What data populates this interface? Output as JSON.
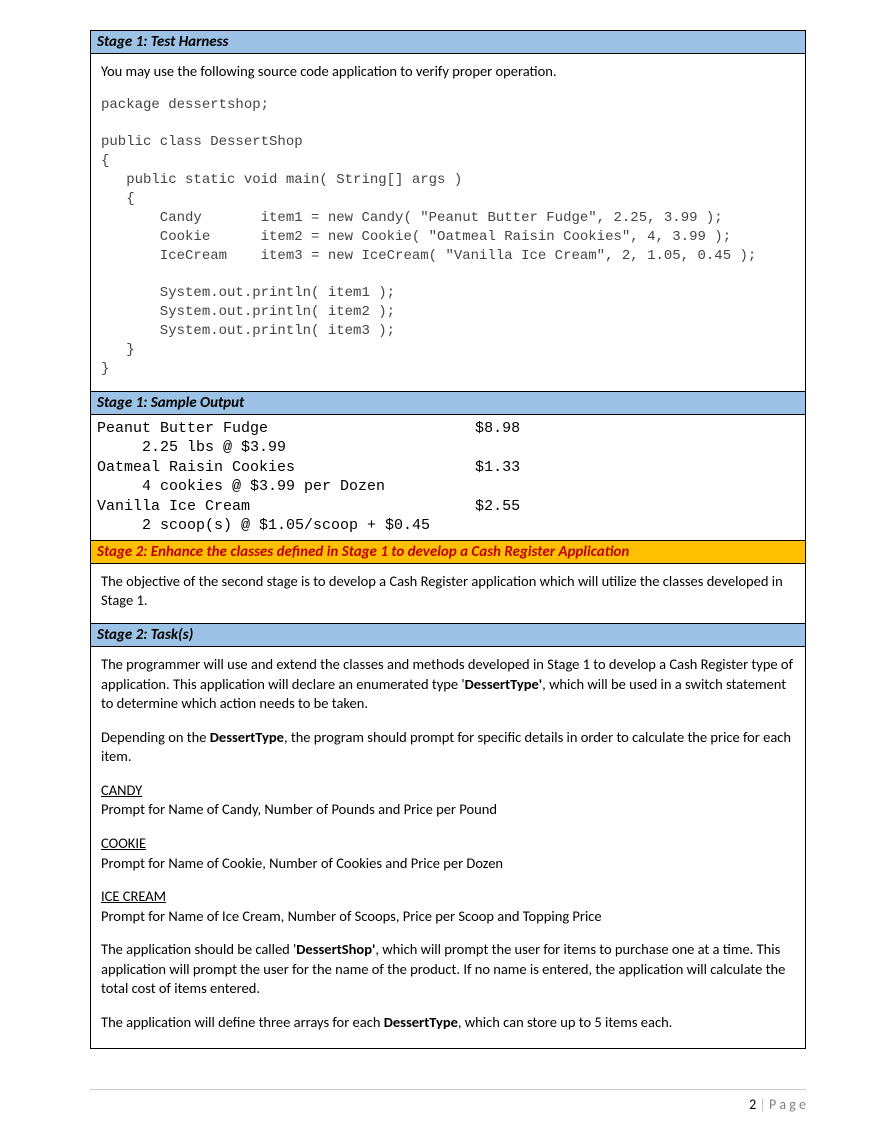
{
  "headers": {
    "s1": "Stage 1: Test Harness",
    "s1out": "Stage 1: Sample Output",
    "s2title": "Stage 2: Enhance the classes defined in Stage 1 to develop a Cash Register Application",
    "s2tasks": "Stage 2:  Task(s)"
  },
  "harness": {
    "intro": "You may use the following source code application to verify proper operation.",
    "code": "package dessertshop;\n\npublic class DessertShop\n{\n   public static void main( String[] args )\n   {\n       Candy       item1 = new Candy( \"Peanut Butter Fudge\", 2.25, 3.99 );\n       Cookie      item2 = new Cookie( \"Oatmeal Raisin Cookies\", 4, 3.99 );\n       IceCream    item3 = new IceCream( \"Vanilla Ice Cream\", 2, 1.05, 0.45 );\n\n       System.out.println( item1 );\n       System.out.println( item2 );\n       System.out.println( item3 );\n   }\n}"
  },
  "output": "Peanut Butter Fudge                       $8.98\n     2.25 lbs @ $3.99\nOatmeal Raisin Cookies                    $1.33\n     4 cookies @ $3.99 per Dozen\nVanilla Ice Cream                         $2.55\n     2 scoop(s) @ $1.05/scoop + $0.45",
  "stage2": {
    "objective": "The objective of the second stage is to develop a Cash Register application which will utilize the classes developed in Stage 1.",
    "p1a": "The programmer will use and extend the classes and methods developed in Stage 1 to develop a Cash Register type of application.  This application will declare an enumerated type '",
    "p1b": "DessertType'",
    "p1c": ", which will be used in a switch statement to determine which action needs to be taken.",
    "p2a": "Depending on the ",
    "p2b": "DessertType",
    "p2c": ", the program should prompt for specific details in order to calculate the price for each item.",
    "candyH": "CANDY",
    "candy": "Prompt for Name of Candy, Number of Pounds and Price per Pound",
    "cookieH": "COOKIE",
    "cookie": "Prompt for Name of Cookie, Number of Cookies and Price per Dozen",
    "iceH": "ICE CREAM",
    "ice": "Prompt for Name of Ice Cream, Number of Scoops, Price per Scoop and Topping Price",
    "p3a": "The application should be called '",
    "p3b": "DessertShop'",
    "p3c": ", which will prompt the user for items to purchase one at a time.  This application will prompt the user for the name of the product.  If no name is entered, the application will calculate the total cost of items entered.",
    "p4a": "The application will define three arrays for each ",
    "p4b": "DessertType",
    "p4c": ", which can store up to 5 items each."
  },
  "footer": {
    "num": "2",
    "sep": " | ",
    "label": "P a g e"
  }
}
